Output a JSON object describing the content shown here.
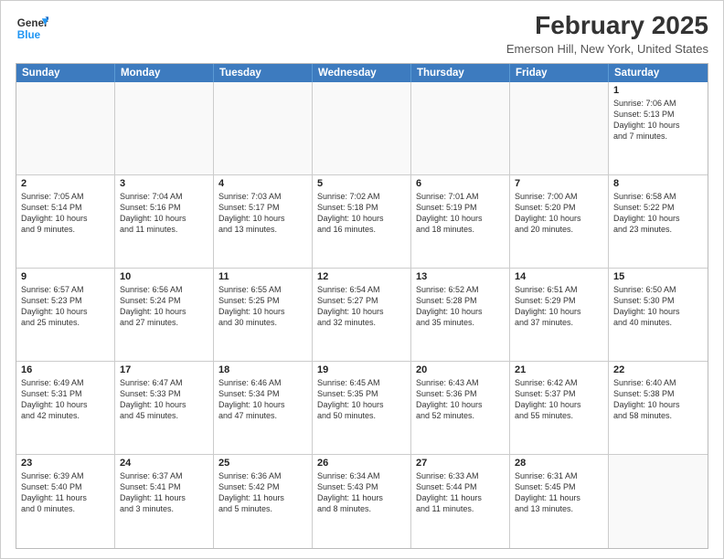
{
  "header": {
    "logo_line1": "General",
    "logo_line2": "Blue",
    "month_title": "February 2025",
    "location": "Emerson Hill, New York, United States"
  },
  "weekdays": [
    "Sunday",
    "Monday",
    "Tuesday",
    "Wednesday",
    "Thursday",
    "Friday",
    "Saturday"
  ],
  "rows": [
    [
      {
        "day": "",
        "info": ""
      },
      {
        "day": "",
        "info": ""
      },
      {
        "day": "",
        "info": ""
      },
      {
        "day": "",
        "info": ""
      },
      {
        "day": "",
        "info": ""
      },
      {
        "day": "",
        "info": ""
      },
      {
        "day": "1",
        "info": "Sunrise: 7:06 AM\nSunset: 5:13 PM\nDaylight: 10 hours\nand 7 minutes."
      }
    ],
    [
      {
        "day": "2",
        "info": "Sunrise: 7:05 AM\nSunset: 5:14 PM\nDaylight: 10 hours\nand 9 minutes."
      },
      {
        "day": "3",
        "info": "Sunrise: 7:04 AM\nSunset: 5:16 PM\nDaylight: 10 hours\nand 11 minutes."
      },
      {
        "day": "4",
        "info": "Sunrise: 7:03 AM\nSunset: 5:17 PM\nDaylight: 10 hours\nand 13 minutes."
      },
      {
        "day": "5",
        "info": "Sunrise: 7:02 AM\nSunset: 5:18 PM\nDaylight: 10 hours\nand 16 minutes."
      },
      {
        "day": "6",
        "info": "Sunrise: 7:01 AM\nSunset: 5:19 PM\nDaylight: 10 hours\nand 18 minutes."
      },
      {
        "day": "7",
        "info": "Sunrise: 7:00 AM\nSunset: 5:20 PM\nDaylight: 10 hours\nand 20 minutes."
      },
      {
        "day": "8",
        "info": "Sunrise: 6:58 AM\nSunset: 5:22 PM\nDaylight: 10 hours\nand 23 minutes."
      }
    ],
    [
      {
        "day": "9",
        "info": "Sunrise: 6:57 AM\nSunset: 5:23 PM\nDaylight: 10 hours\nand 25 minutes."
      },
      {
        "day": "10",
        "info": "Sunrise: 6:56 AM\nSunset: 5:24 PM\nDaylight: 10 hours\nand 27 minutes."
      },
      {
        "day": "11",
        "info": "Sunrise: 6:55 AM\nSunset: 5:25 PM\nDaylight: 10 hours\nand 30 minutes."
      },
      {
        "day": "12",
        "info": "Sunrise: 6:54 AM\nSunset: 5:27 PM\nDaylight: 10 hours\nand 32 minutes."
      },
      {
        "day": "13",
        "info": "Sunrise: 6:52 AM\nSunset: 5:28 PM\nDaylight: 10 hours\nand 35 minutes."
      },
      {
        "day": "14",
        "info": "Sunrise: 6:51 AM\nSunset: 5:29 PM\nDaylight: 10 hours\nand 37 minutes."
      },
      {
        "day": "15",
        "info": "Sunrise: 6:50 AM\nSunset: 5:30 PM\nDaylight: 10 hours\nand 40 minutes."
      }
    ],
    [
      {
        "day": "16",
        "info": "Sunrise: 6:49 AM\nSunset: 5:31 PM\nDaylight: 10 hours\nand 42 minutes."
      },
      {
        "day": "17",
        "info": "Sunrise: 6:47 AM\nSunset: 5:33 PM\nDaylight: 10 hours\nand 45 minutes."
      },
      {
        "day": "18",
        "info": "Sunrise: 6:46 AM\nSunset: 5:34 PM\nDaylight: 10 hours\nand 47 minutes."
      },
      {
        "day": "19",
        "info": "Sunrise: 6:45 AM\nSunset: 5:35 PM\nDaylight: 10 hours\nand 50 minutes."
      },
      {
        "day": "20",
        "info": "Sunrise: 6:43 AM\nSunset: 5:36 PM\nDaylight: 10 hours\nand 52 minutes."
      },
      {
        "day": "21",
        "info": "Sunrise: 6:42 AM\nSunset: 5:37 PM\nDaylight: 10 hours\nand 55 minutes."
      },
      {
        "day": "22",
        "info": "Sunrise: 6:40 AM\nSunset: 5:38 PM\nDaylight: 10 hours\nand 58 minutes."
      }
    ],
    [
      {
        "day": "23",
        "info": "Sunrise: 6:39 AM\nSunset: 5:40 PM\nDaylight: 11 hours\nand 0 minutes."
      },
      {
        "day": "24",
        "info": "Sunrise: 6:37 AM\nSunset: 5:41 PM\nDaylight: 11 hours\nand 3 minutes."
      },
      {
        "day": "25",
        "info": "Sunrise: 6:36 AM\nSunset: 5:42 PM\nDaylight: 11 hours\nand 5 minutes."
      },
      {
        "day": "26",
        "info": "Sunrise: 6:34 AM\nSunset: 5:43 PM\nDaylight: 11 hours\nand 8 minutes."
      },
      {
        "day": "27",
        "info": "Sunrise: 6:33 AM\nSunset: 5:44 PM\nDaylight: 11 hours\nand 11 minutes."
      },
      {
        "day": "28",
        "info": "Sunrise: 6:31 AM\nSunset: 5:45 PM\nDaylight: 11 hours\nand 13 minutes."
      },
      {
        "day": "",
        "info": ""
      }
    ]
  ]
}
